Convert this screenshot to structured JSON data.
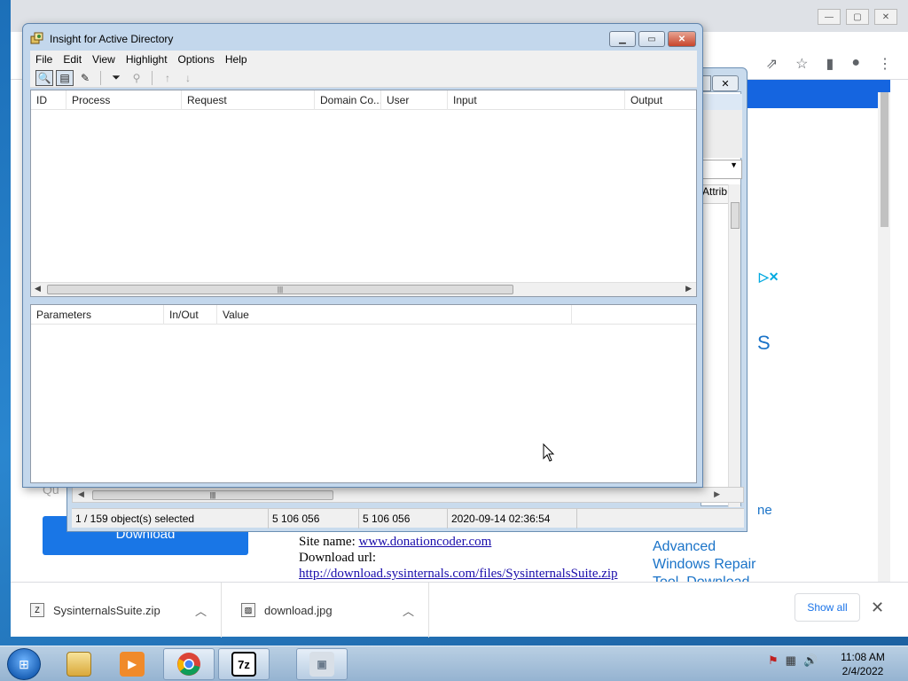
{
  "main_window": {
    "title": "Insight for Active Directory",
    "menu": [
      "File",
      "Edit",
      "View",
      "Highlight",
      "Options",
      "Help"
    ],
    "top_columns": [
      "ID",
      "Process",
      "Request",
      "Domain Co...",
      "User",
      "Input",
      "Output"
    ],
    "bottom_columns": [
      "Parameters",
      "In/Out",
      "Value"
    ]
  },
  "back_window": {
    "column_partial": "Attrib",
    "status": {
      "selected": "1 / 159 object(s) selected",
      "value1": "5 106 056",
      "value2": "5 106 056",
      "timestamp": "2020-09-14 02:36:54"
    }
  },
  "browser": {
    "download_button": "Download",
    "partial_text": "Qu",
    "site_name_label": "Site name:",
    "site_name": "www.donationcoder.com",
    "download_url_label": "Download url:",
    "download_url": "http://download.sysinternals.com/files/SysinternalsSuite.zip",
    "side_ad": [
      "Advanced",
      "Windows Repair",
      "Tool. Download"
    ],
    "partial_ad_letter": "S",
    "partial_ad_text": "ne",
    "downloads": [
      {
        "name": "SysinternalsSuite.zip"
      },
      {
        "name": "download.jpg"
      }
    ],
    "show_all": "Show all"
  },
  "taskbar": {
    "clock_time": "11:08 AM",
    "clock_date": "2/4/2022"
  },
  "colors": {
    "accent": "#1976e6",
    "link": "#1a0dab",
    "window_frame": "#c3d7ec"
  }
}
